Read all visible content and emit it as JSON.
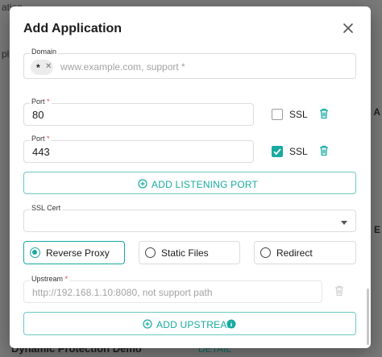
{
  "background": {
    "top_left_line1": "ation",
    "top_left_line2": "pli",
    "right_letters": [
      "A",
      "E"
    ],
    "bottom_title": "Dynamic Protection Demo",
    "bottom_detail": "DETAIL"
  },
  "modal": {
    "title": "Add Application",
    "close_icon": "close-icon"
  },
  "domain": {
    "label": "Domain",
    "chip": "*",
    "placeholder": "www.example.com, support *"
  },
  "ports": [
    {
      "label": "Port",
      "required_mark": "*",
      "value": "80",
      "ssl_label": "SSL",
      "ssl_checked": false
    },
    {
      "label": "Port",
      "required_mark": "*",
      "value": "443",
      "ssl_label": "SSL",
      "ssl_checked": true
    }
  ],
  "add_listening_port": {
    "label": "ADD LISTENING PORT",
    "icon": "plus-circle-icon"
  },
  "ssl_cert": {
    "label": "SSL Cert",
    "value": ""
  },
  "modes": [
    {
      "label": "Reverse Proxy",
      "selected": true
    },
    {
      "label": "Static Files",
      "selected": false
    },
    {
      "label": "Redirect",
      "selected": false
    }
  ],
  "upstream": {
    "label": "Upstream",
    "required_mark": "*",
    "placeholder": "http://192.168.1.10:8080, not support path"
  },
  "add_upstream": {
    "label": "ADD UPSTREAM",
    "icon": "plus-circle-icon",
    "badge_icon": "info-badge-icon"
  },
  "colors": {
    "accent": "#17aaa0",
    "required": "#e0453b"
  }
}
